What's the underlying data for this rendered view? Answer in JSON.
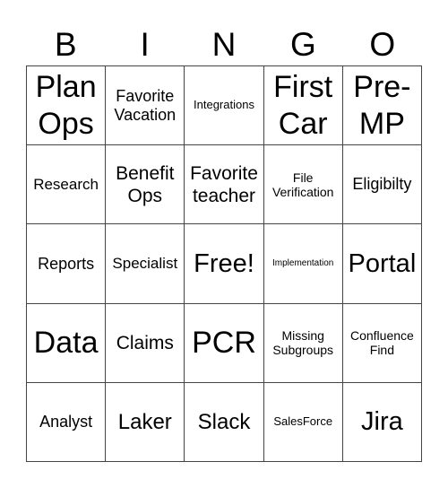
{
  "header": {
    "letters": [
      "B",
      "I",
      "N",
      "G",
      "O"
    ]
  },
  "cells": [
    "Plan Ops",
    "Favorite Vacation",
    "Integrations",
    "First Car",
    "Pre-MP",
    "Research",
    "Benefit Ops",
    "Favorite teacher",
    "File Verification",
    "Eligibilty",
    "Reports",
    "Specialist",
    "Free!",
    "Implementation",
    "Portal",
    "Data",
    "Claims",
    "PCR",
    "Missing Subgroups",
    "Confluence Find",
    "Analyst",
    "Laker",
    "Slack",
    "SalesForce",
    "Jira"
  ]
}
